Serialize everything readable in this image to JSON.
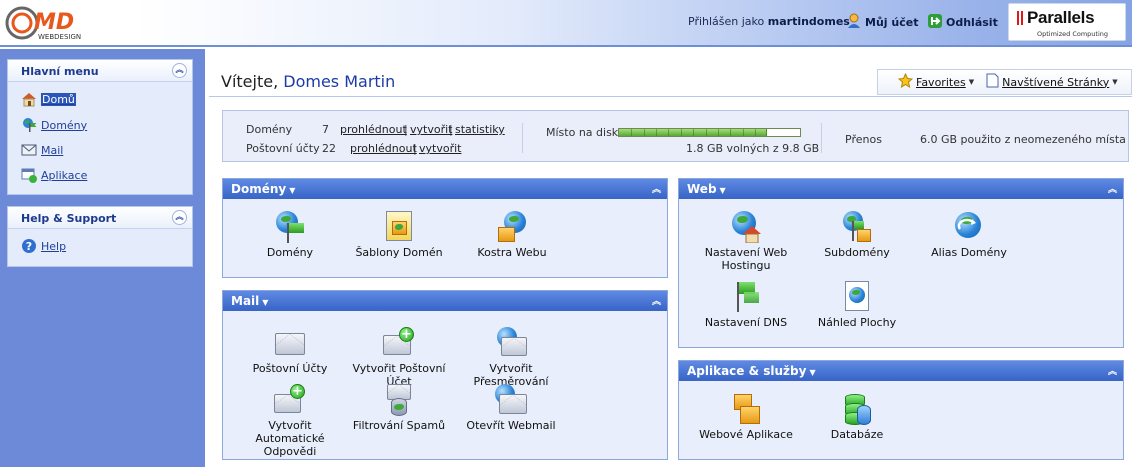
{
  "header": {
    "logo_text": "MD",
    "logo_sub": "WEBDESIGN",
    "logged_in_prefix": "Přihlášen jako",
    "username": "martindomes",
    "my_account": "Můj účet",
    "logout": "Odhlásit",
    "brand": "Parallels",
    "brand_sub": "Optimized Computing"
  },
  "sidebar": {
    "main_menu": {
      "title": "Hlavní menu",
      "items": [
        {
          "label": "Domů",
          "icon": "home-icon",
          "active": true
        },
        {
          "label": "Domény",
          "icon": "domains-icon"
        },
        {
          "label": "Mail",
          "icon": "mail-icon"
        },
        {
          "label": "Aplikace",
          "icon": "applications-icon"
        }
      ]
    },
    "help_support": {
      "title": "Help & Support",
      "items": [
        {
          "label": "Help",
          "icon": "help-icon"
        }
      ]
    }
  },
  "main": {
    "welcome": "Vítejte,",
    "user_name": "Domes Martin",
    "toolbar": {
      "favorites": "Favorites",
      "visited": "Navštívené Stránky"
    },
    "stats": {
      "domains_label": "Domény",
      "domains_count": "7",
      "mail_label": "Poštovní účty",
      "mail_count": "22",
      "view": "prohlédnout",
      "create": "vytvořit",
      "statistics": "statistiky",
      "sep": "|",
      "disk_label": "Místo na disku",
      "disk_used_fraction": 0.82,
      "disk_text": "1.8 GB volných z 9.8 GB",
      "transfer_label": "Přenos",
      "transfer_text": "6.0 GB použito z neomezeného místa"
    },
    "panels": {
      "domains": {
        "title": "Domény",
        "tiles": [
          {
            "label": "Domény",
            "icon": "domains-globe-icon"
          },
          {
            "label": "Šablony Domén",
            "icon": "domain-templates-icon"
          },
          {
            "label": "Kostra Webu",
            "icon": "site-skeleton-icon"
          }
        ]
      },
      "mail": {
        "title": "Mail",
        "tiles": [
          {
            "label": "Poštovní Účty",
            "icon": "mail-accounts-icon"
          },
          {
            "label": "Vytvořit Poštovní Účet",
            "icon": "create-mail-account-icon"
          },
          {
            "label": "Vytvořit Přesměrování",
            "icon": "create-forwarding-icon"
          },
          {
            "label": "Vytvořit Automatické Odpovědi",
            "icon": "create-autoresponder-icon"
          },
          {
            "label": "Filtrování Spamů",
            "icon": "spam-filter-icon"
          },
          {
            "label": "Otevřít Webmail",
            "icon": "webmail-icon"
          }
        ]
      },
      "web": {
        "title": "Web",
        "tiles": [
          {
            "label": "Nastavení Web Hostingu",
            "icon": "web-hosting-settings-icon"
          },
          {
            "label": "Subdomény",
            "icon": "subdomains-icon"
          },
          {
            "label": "Alias Domény",
            "icon": "domain-alias-icon"
          },
          {
            "label": "Nastavení DNS",
            "icon": "dns-settings-icon"
          },
          {
            "label": "Náhled Plochy",
            "icon": "site-preview-icon"
          }
        ]
      },
      "apps": {
        "title": "Aplikace & služby",
        "tiles": [
          {
            "label": "Webové Aplikace",
            "icon": "web-applications-icon"
          },
          {
            "label": "Databáze",
            "icon": "databases-icon"
          }
        ]
      }
    }
  }
}
